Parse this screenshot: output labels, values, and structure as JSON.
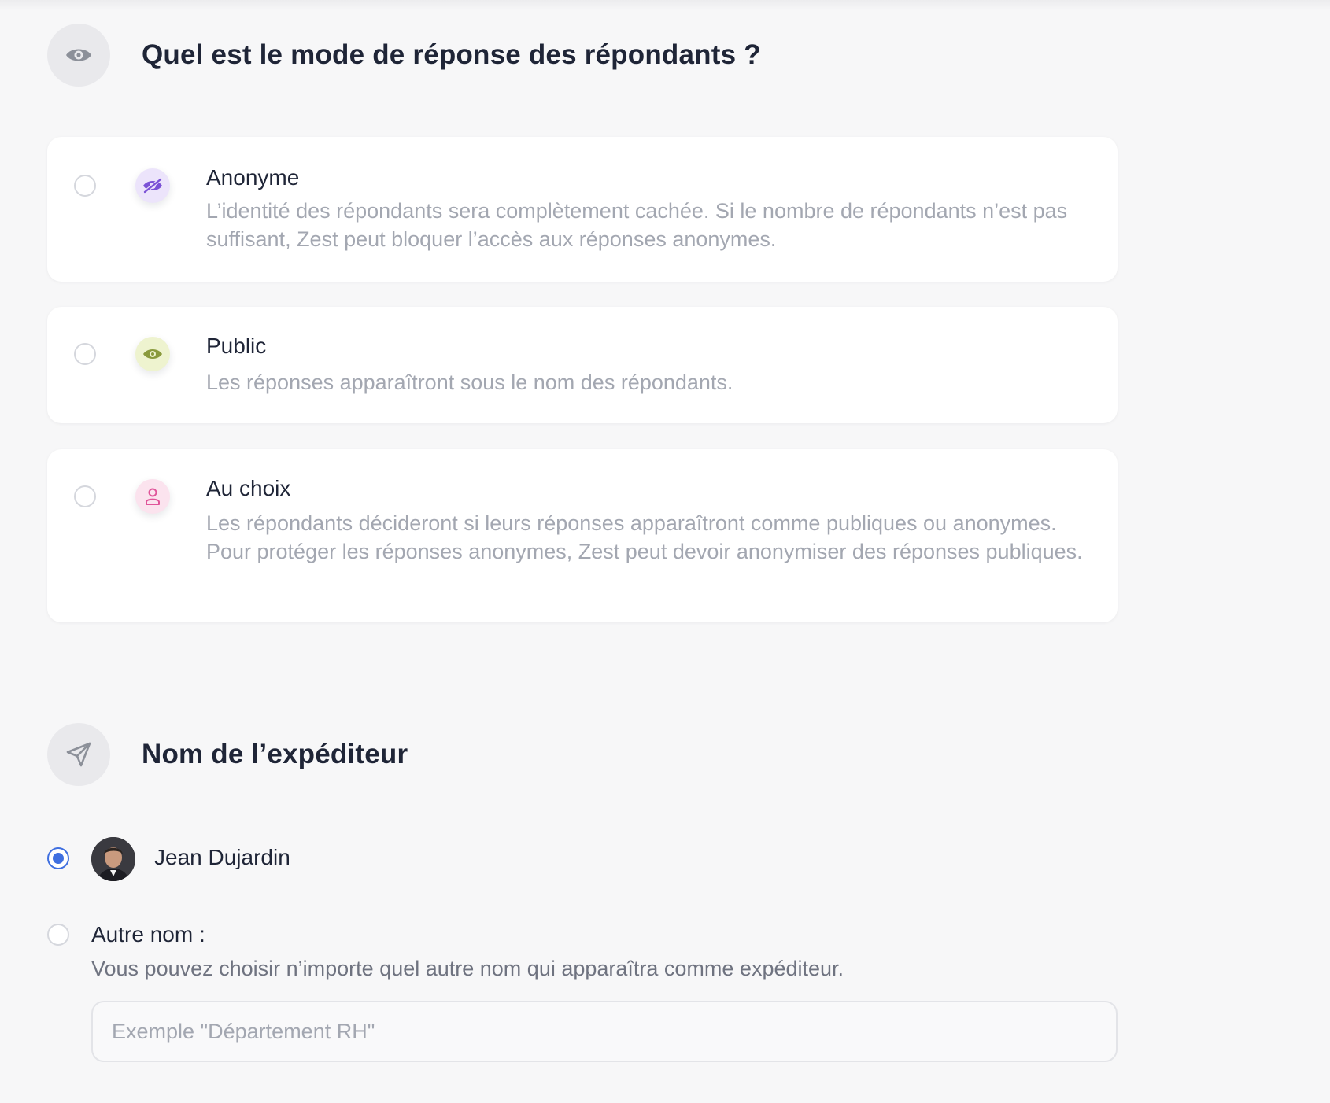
{
  "response_mode": {
    "title": "Quel est le mode de réponse des répondants ?",
    "section_icon": "eye-icon",
    "options": [
      {
        "title": "Anonyme",
        "description": "L’identité des répondants sera complètement cachée. Si le nombre de répondants n’est pas suffisant, Zest peut bloquer l’accès aux réponses anonymes.",
        "icon": "eye-slash-icon",
        "icon_color": "#7b52d6",
        "icon_bg": "#ece4fb",
        "selected": false
      },
      {
        "title": "Public",
        "description": "Les réponses apparaîtront sous le nom des répondants.",
        "icon": "eye-icon",
        "icon_color": "#8a9a3c",
        "icon_bg": "#eef3cf",
        "selected": false
      },
      {
        "title": "Au choix",
        "description": "Les répondants décideront si leurs réponses apparaîtront comme publiques ou anonymes. Pour protéger les réponses anonymes, Zest peut devoir anonymiser des réponses publiques.",
        "icon": "user-icon",
        "icon_color": "#e0559a",
        "icon_bg": "#fbe3ee",
        "selected": false
      }
    ]
  },
  "sender": {
    "title": "Nom de l’expéditeur",
    "section_icon": "send-icon",
    "default_option": {
      "name": "Jean Dujardin",
      "selected": true
    },
    "other_option": {
      "label": "Autre nom :",
      "description": "Vous pouvez choisir n’importe quel autre nom qui apparaîtra comme expéditeur.",
      "placeholder": "Exemple \"Département RH\"",
      "value": "",
      "selected": false
    }
  },
  "colors": {
    "accent": "#3f6fe0",
    "background": "#f7f7f8",
    "text": "#1f2537",
    "muted_text": "#a3a7b1"
  }
}
